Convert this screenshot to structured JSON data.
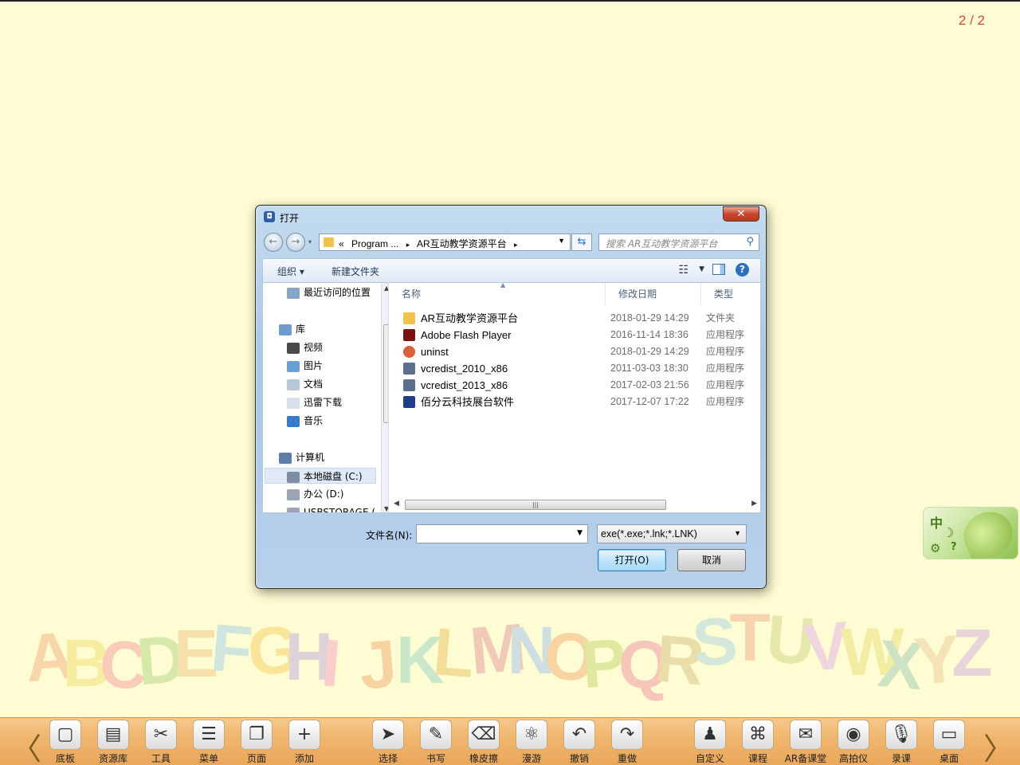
{
  "page_indicator": "2 / 2",
  "alphabet": "ABCDEFGHIJKLMNOPQRSTUVWXYZ",
  "ime": {
    "mode": "中",
    "moon": "☽",
    "gear": "⚙",
    "help": "?"
  },
  "dialog": {
    "title": "打开",
    "close_label": "✕",
    "address": {
      "prefix": "«",
      "crumbs": [
        "Program ...",
        "AR互动教学资源平台"
      ],
      "sep": "▸"
    },
    "search_placeholder": "搜索 AR互动教学资源平台",
    "toolbar": {
      "organize": "组织 ▾",
      "new_folder": "新建文件夹"
    },
    "nav": [
      {
        "label": "最近访问的位置",
        "icon": "recent-places-icon",
        "color": "#8aa6c6"
      },
      {
        "label": "库",
        "icon": "library-icon",
        "color": "#6f9ccf"
      },
      {
        "label": "视频",
        "icon": "video-icon",
        "color": "#4a4a4a"
      },
      {
        "label": "图片",
        "icon": "picture-icon",
        "color": "#6aa0d8"
      },
      {
        "label": "文档",
        "icon": "document-icon",
        "color": "#b9c7d8"
      },
      {
        "label": "迅雷下载",
        "icon": "download-folder-icon",
        "color": "#d7dfe8"
      },
      {
        "label": "音乐",
        "icon": "music-icon",
        "color": "#3a78c9"
      },
      {
        "label": "计算机",
        "icon": "computer-icon",
        "color": "#5b7fa8"
      },
      {
        "label": "本地磁盘 (C:)",
        "icon": "local-disk-icon",
        "color": "#7d8ea2"
      },
      {
        "label": "办公 (D:)",
        "icon": "drive-icon",
        "color": "#9aa6b4"
      },
      {
        "label": "USBSTORAGE (",
        "icon": "usb-drive-icon",
        "color": "#9aa6b4"
      }
    ],
    "columns": {
      "name": "名称",
      "modified": "修改日期",
      "type": "类型"
    },
    "files": [
      {
        "name": "AR互动教学资源平台",
        "date": "2018-01-29 14:29",
        "type": "文件夹",
        "icon": "folder-icon",
        "color": "#f2c24f"
      },
      {
        "name": "Adobe Flash Player",
        "date": "2016-11-14 18:36",
        "type": "应用程序",
        "icon": "flash-icon",
        "color": "#7a1010"
      },
      {
        "name": "uninst",
        "date": "2018-01-29 14:29",
        "type": "应用程序",
        "icon": "uninstall-icon",
        "color": "#d9603b"
      },
      {
        "name": "vcredist_2010_x86",
        "date": "2011-03-03 18:30",
        "type": "应用程序",
        "icon": "installer-icon",
        "color": "#5c6f8c"
      },
      {
        "name": "vcredist_2013_x86",
        "date": "2017-02-03 21:56",
        "type": "应用程序",
        "icon": "installer-icon",
        "color": "#5c6f8c"
      },
      {
        "name": "佰分云科技展台软件",
        "date": "2017-12-07 17:22",
        "type": "应用程序",
        "icon": "app-icon",
        "color": "#1f3f8a"
      }
    ],
    "filename_label": "文件名(N):",
    "filename_value": "",
    "filter_value": "exe(*.exe;*.lnk;*.LNK)",
    "open_label": "打开(O)",
    "cancel_label": "取消"
  },
  "taskbar": {
    "tools": [
      {
        "label": "底板",
        "glyph": "▢"
      },
      {
        "label": "资源库",
        "glyph": "▤"
      },
      {
        "label": "工具",
        "glyph": "✂"
      },
      {
        "label": "菜单",
        "glyph": "☰"
      },
      {
        "label": "页面",
        "glyph": "❐"
      },
      {
        "label": "添加",
        "glyph": "+"
      },
      {
        "label": "选择",
        "glyph": "➤"
      },
      {
        "label": "书写",
        "glyph": "✎"
      },
      {
        "label": "橡皮擦",
        "glyph": "⌫"
      },
      {
        "label": "漫游",
        "glyph": "⚛"
      },
      {
        "label": "撤销",
        "glyph": "↶"
      },
      {
        "label": "重做",
        "glyph": "↷"
      },
      {
        "label": "自定义",
        "glyph": "♟"
      },
      {
        "label": "课程",
        "glyph": "⌘"
      },
      {
        "label": "AR备课堂",
        "glyph": "✉"
      },
      {
        "label": "高拍仪",
        "glyph": "◉"
      },
      {
        "label": "录课",
        "glyph": "🎙"
      },
      {
        "label": "桌面",
        "glyph": "▭"
      }
    ]
  }
}
